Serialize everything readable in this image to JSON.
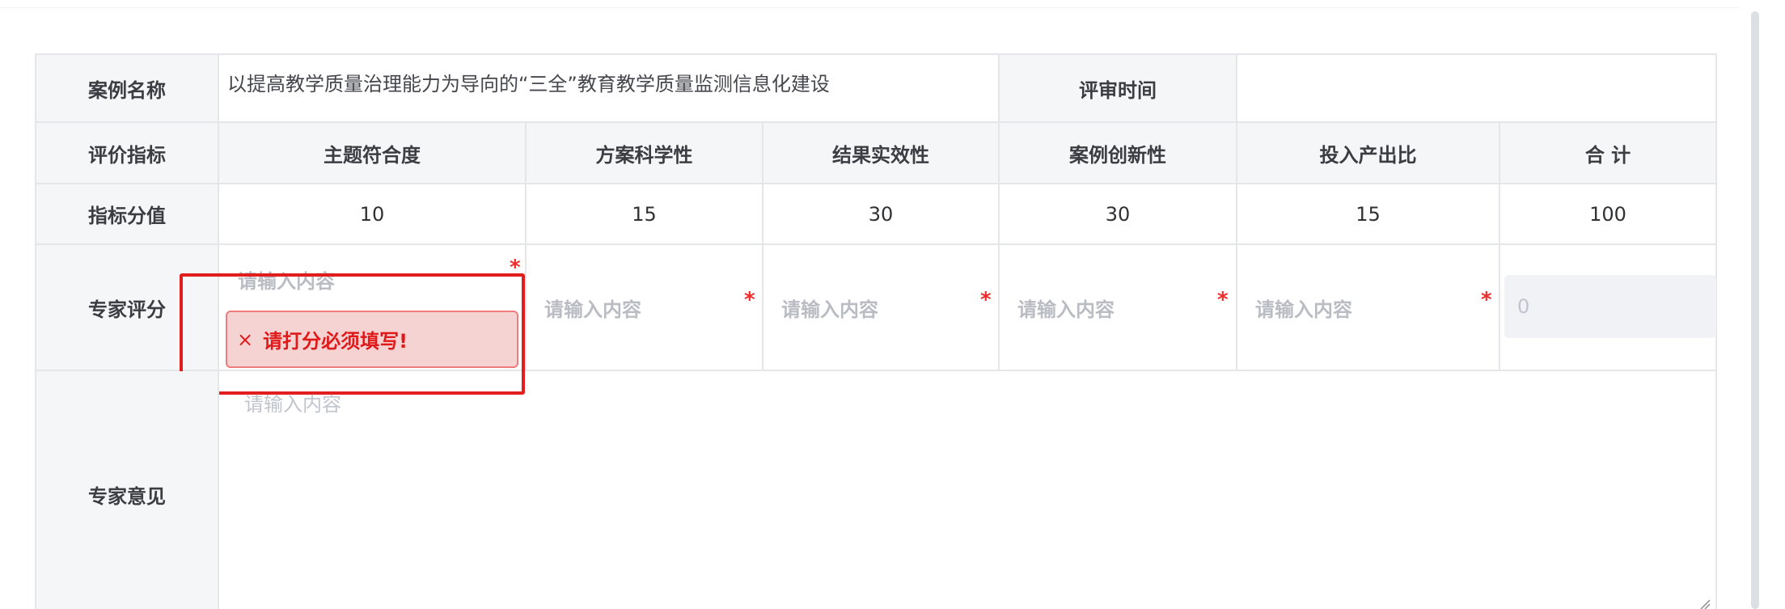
{
  "form": {
    "case_name_label": "案例名称",
    "case_name_value": "以提高教学质量治理能力为导向的“三全”教育教学质量监测信息化建设",
    "review_time_label": "评审时间",
    "review_time_value": "",
    "index_label": "评价指标",
    "score_label": "指标分值",
    "expert_score_label": "专家评分",
    "expert_opinion_label": "专家意见",
    "columns": [
      {
        "header": "主题符合度",
        "score": "10"
      },
      {
        "header": "方案科学性",
        "score": "15"
      },
      {
        "header": "结果实效性",
        "score": "30"
      },
      {
        "header": "案例创新性",
        "score": "30"
      },
      {
        "header": "投入产出比",
        "score": "15"
      }
    ],
    "total_header": "合 计",
    "total_score": "100",
    "input_placeholder": "请输入内容",
    "total_value": "0",
    "required_mark": "*",
    "opinion_placeholder": "请输入内容",
    "error_icon": "×",
    "error_message": "请打分必须填写!"
  },
  "colors": {
    "error_red": "#e01a1a",
    "highlight_red": "#e11d1d",
    "header_bg": "#f5f6f7",
    "border": "#e4e6ea"
  }
}
